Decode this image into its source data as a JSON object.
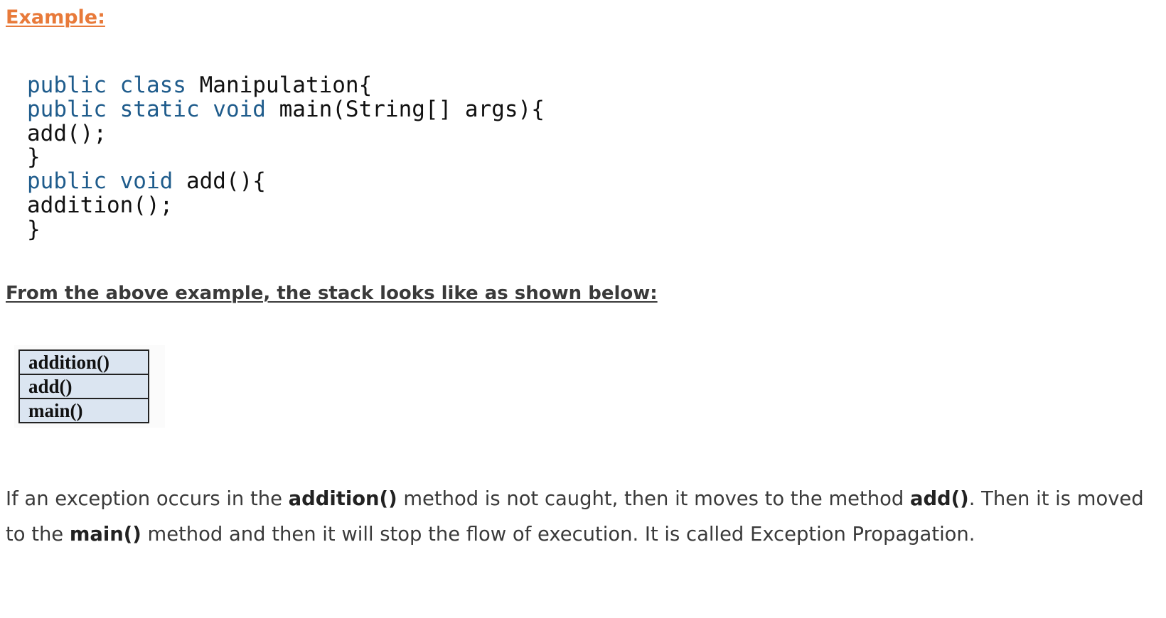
{
  "example_heading": "Example:",
  "code": {
    "lines": [
      [
        {
          "t": "public class",
          "k": true
        },
        {
          "t": " Manipulation{",
          "k": false
        }
      ],
      [
        {
          "t": "public static void",
          "k": true
        },
        {
          "t": " main(String[] args){",
          "k": false
        }
      ],
      [
        {
          "t": "add();",
          "k": false
        }
      ],
      [
        {
          "t": "}",
          "k": false
        }
      ],
      [
        {
          "t": "public void",
          "k": true
        },
        {
          "t": " add(){",
          "k": false
        }
      ],
      [
        {
          "t": "addition();",
          "k": false
        }
      ],
      [
        {
          "t": "}",
          "k": false
        }
      ]
    ],
    "keyword_color": "#1f5c8c",
    "text_color": "#111111"
  },
  "stack_heading": "From the above example, the stack looks like as shown below:",
  "stack": {
    "frames": [
      "addition()",
      "add()",
      "main()"
    ],
    "cell_color": "#dbe5f1"
  },
  "paragraph": {
    "parts": [
      {
        "t": "If an exception occurs in the ",
        "b": false
      },
      {
        "t": "addition()",
        "b": true
      },
      {
        "t": " method is not caught, then it moves to the method ",
        "b": false
      },
      {
        "t": "add()",
        "b": true
      },
      {
        "t": ". Then it is moved to the ",
        "b": false
      },
      {
        "t": "main()",
        "b": true
      },
      {
        "t": " method and then it will stop the flow of execution. It is called Exception Propagation.",
        "b": false
      }
    ]
  },
  "colors": {
    "heading_accent": "#e87a3a",
    "heading_dark": "#3a3a3a",
    "body_text": "#3a3a3a"
  }
}
